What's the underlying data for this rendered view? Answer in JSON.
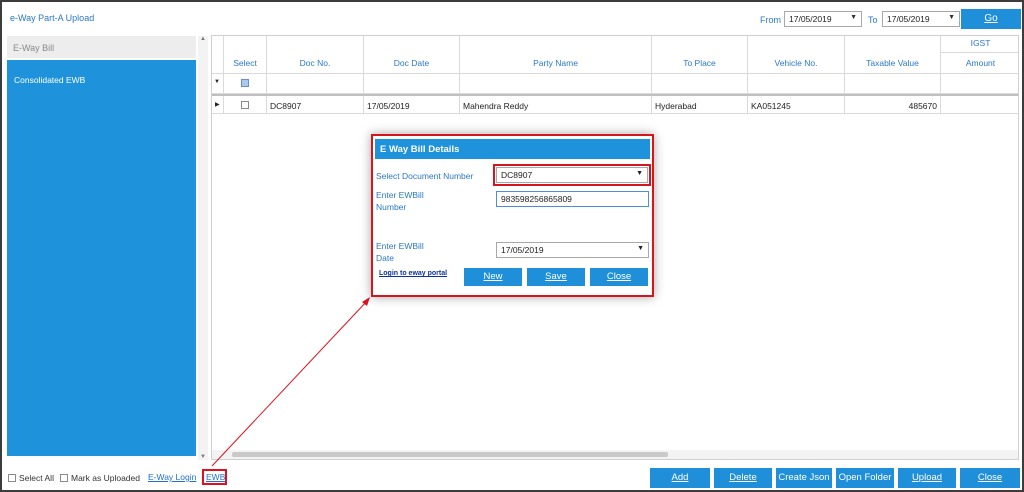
{
  "app": {
    "title": "e-Way Part-A Upload"
  },
  "header": {
    "from_label": "From",
    "from_date": "17/05/2019",
    "to_label": "To",
    "to_date": "17/05/2019",
    "go_label": "Go"
  },
  "sidebar": {
    "header": "E-Way Bill",
    "items": [
      {
        "label": "Consolidated EWB"
      }
    ]
  },
  "grid": {
    "group_header": "IGST",
    "columns": [
      "Select",
      "Doc No.",
      "Doc Date",
      "Party Name",
      "To Place",
      "Vehicle No.",
      "Taxable Value",
      "Amount"
    ],
    "rows": [
      {
        "doc_no": "DC8907",
        "doc_date": "17/05/2019",
        "party_name": "Mahendra Reddy",
        "to_place": "Hyderabad",
        "vehicle_no": "KA051245",
        "taxable_value": "485670",
        "amount": ""
      }
    ]
  },
  "footer": {
    "select_all": "Select All",
    "mark_uploaded": "Mark as Uploaded",
    "eway_login": "E-Way Login",
    "ewb": "EWB",
    "buttons": [
      "Add",
      "Delete",
      "Create Json",
      "Open Folder",
      "Upload",
      "Close"
    ]
  },
  "dialog": {
    "title": "E Way Bill Details",
    "doc_number_label": "Select Document Number",
    "doc_number_value": "DC8907",
    "ewbill_number_label_1": "Enter EWBill",
    "ewbill_number_label_2": "Number",
    "ewbill_number_value": "983598256865809",
    "ewbill_date_label_1": "Enter EWBill",
    "ewbill_date_label_2": "Date",
    "ewbill_date_value": "17/05/2019",
    "portal_link": "Login to eway portal",
    "buttons": [
      "New",
      "Save",
      "Close"
    ]
  },
  "colors": {
    "accent": "#1e93db",
    "highlight": "#d4161f",
    "label": "#2a78c8"
  }
}
